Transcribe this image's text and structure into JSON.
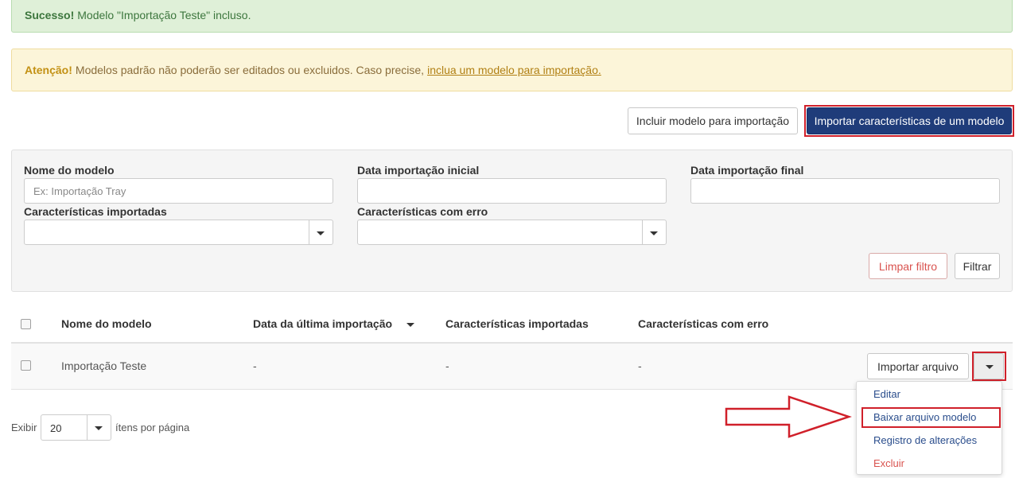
{
  "alerts": {
    "success_strong": "Sucesso!",
    "success_text": "Modelo \"Importação Teste\" incluso.",
    "warning_strong": "Atenção!",
    "warning_text": "Modelos padrão não poderão ser editados ou excluidos. Caso precise,",
    "warning_link": "inclua um modelo para importação."
  },
  "toolbar": {
    "include_label": "Incluir modelo para importação",
    "import_label": "Importar características de um modelo"
  },
  "filters": {
    "name_label": "Nome do modelo",
    "name_placeholder": "Ex: Importação Tray",
    "date_start_label": "Data importação inicial",
    "date_end_label": "Data importação final",
    "imported_label": "Características importadas",
    "error_label": "Características com erro",
    "clear_label": "Limpar filtro",
    "filter_label": "Filtrar"
  },
  "table": {
    "headers": {
      "name": "Nome do modelo",
      "last_import": "Data da última importação",
      "imported": "Características importadas",
      "errors": "Características com erro"
    },
    "rows": [
      {
        "name": "Importação Teste",
        "last_import": "-",
        "imported": "-",
        "errors": "-",
        "import_button": "Importar arquivo"
      }
    ]
  },
  "dropdown_menu": {
    "items": [
      "Editar",
      "Baixar arquivo modelo",
      "Registro de alterações",
      "Excluir"
    ]
  },
  "pagination": {
    "show_label": "Exibir",
    "page_size": "20",
    "per_page_label": "ítens por página"
  },
  "colors": {
    "primary": "#1f3c7a",
    "highlight": "#d0202a",
    "success_bg": "#dff0d8",
    "warning_bg": "#fcf5d9"
  }
}
